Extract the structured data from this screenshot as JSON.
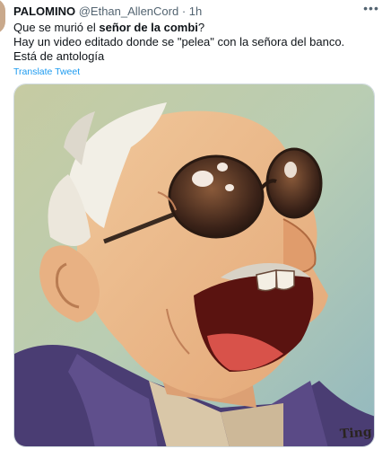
{
  "tweet": {
    "author_name": "PALOMINO",
    "author_handle": "@Ethan_AllenCord",
    "separator": "·",
    "time": "1h",
    "more_icon": "more-horizontal-icon",
    "lines": [
      {
        "pre": "Que se murió el ",
        "bold": "señor de la combi",
        "post": "?"
      },
      {
        "text": "Hay un video editado donde se \"pelea\" con la señora del banco."
      },
      {
        "text": "Está de antología"
      }
    ],
    "translate_label": "Translate Tweet"
  },
  "media": {
    "signature": "Ting"
  }
}
